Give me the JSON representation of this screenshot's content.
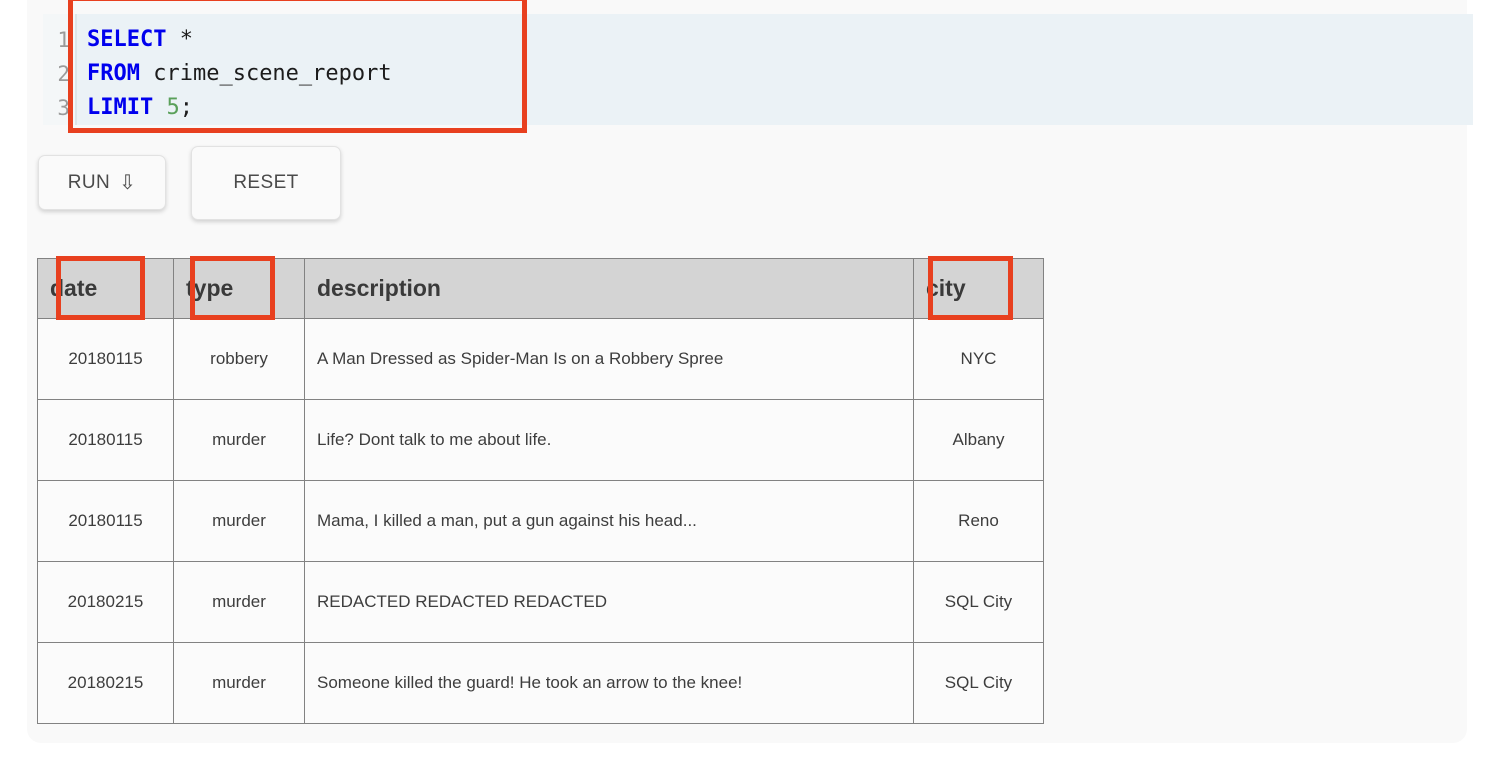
{
  "editor": {
    "lines": [
      {
        "number": "1",
        "tokens": [
          {
            "t": "kw",
            "v": "SELECT"
          },
          {
            "t": "op",
            "v": " *"
          }
        ]
      },
      {
        "number": "2",
        "tokens": [
          {
            "t": "kw",
            "v": "FROM"
          },
          {
            "t": "op",
            "v": " crime_scene_report"
          }
        ]
      },
      {
        "number": "3",
        "tokens": [
          {
            "t": "kw",
            "v": "LIMIT"
          },
          {
            "t": "op",
            "v": " "
          },
          {
            "t": "num",
            "v": "5"
          },
          {
            "t": "op",
            "v": ";"
          }
        ]
      }
    ],
    "line_numbers": [
      "1",
      "2",
      "3"
    ],
    "query_text": "SELECT *\nFROM crime_scene_report\nLIMIT 5;",
    "keyword_color": "#0000ee",
    "number_color": "#5aa05a",
    "background_color": "#ebf2f6"
  },
  "toolbar": {
    "run_label": "RUN",
    "run_icon": "downwards-arrow-icon",
    "run_arrow_glyph": "⇩",
    "reset_label": "RESET"
  },
  "results": {
    "columns": [
      "date",
      "type",
      "description",
      "city"
    ],
    "rows": [
      {
        "date": "20180115",
        "type": "robbery",
        "description": "A Man Dressed as Spider-Man Is on a Robbery Spree",
        "city": "NYC"
      },
      {
        "date": "20180115",
        "type": "murder",
        "description": "Life? Dont talk to me about life.",
        "city": "Albany"
      },
      {
        "date": "20180115",
        "type": "murder",
        "description": "Mama, I killed a man, put a gun against his head...",
        "city": "Reno"
      },
      {
        "date": "20180215",
        "type": "murder",
        "description": "REDACTED REDACTED REDACTED",
        "city": "SQL City"
      },
      {
        "date": "20180215",
        "type": "murder",
        "description": "Someone killed the guard! He took an arrow to the knee!",
        "city": "SQL City"
      }
    ]
  },
  "annotations": {
    "color": "#e8401f",
    "boxes": [
      "sql-editor",
      "date-header",
      "type-header",
      "city-header"
    ]
  }
}
